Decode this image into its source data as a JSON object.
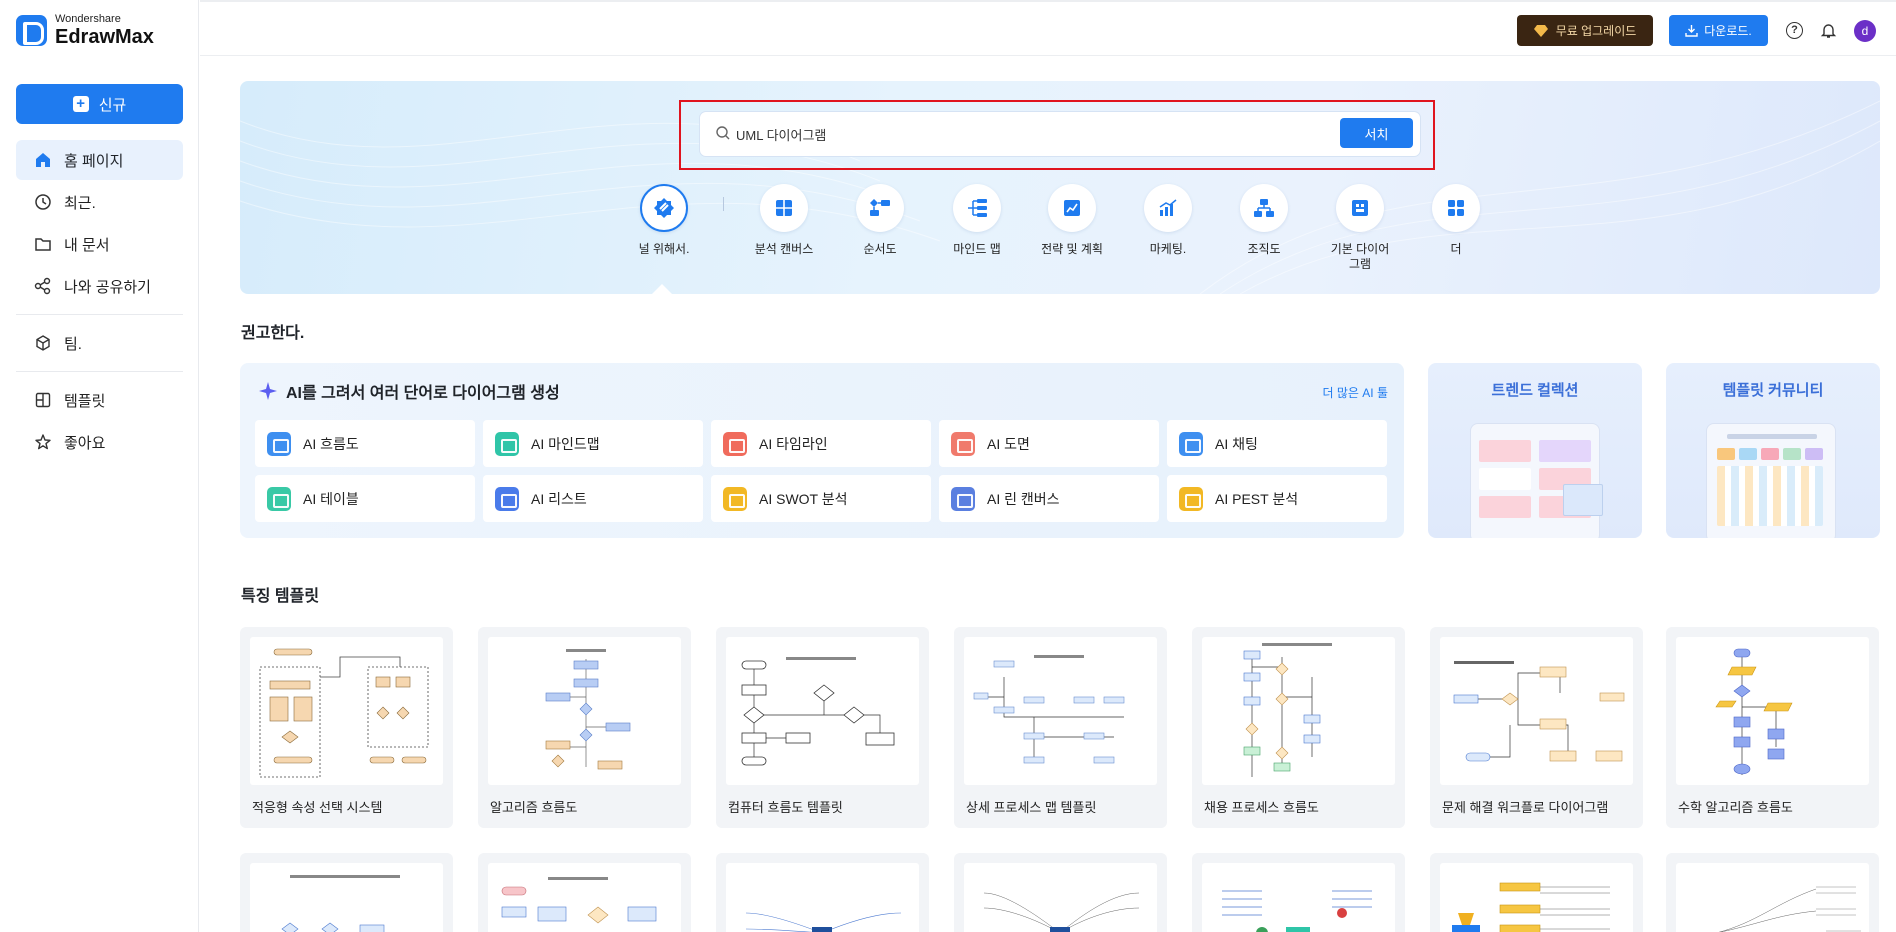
{
  "brand": {
    "sub": "Wondershare",
    "name": "EdrawMax",
    "color": "#1f7bef"
  },
  "sidebar": {
    "new_label": "신규",
    "items": [
      {
        "label": "홈 페이지",
        "icon": "home-icon",
        "active": true
      },
      {
        "label": "최근.",
        "icon": "clock-icon"
      },
      {
        "label": "내 문서",
        "icon": "folder-icon"
      },
      {
        "label": "나와 공유하기",
        "icon": "share-icon"
      },
      {
        "label": "팀.",
        "icon": "cube-icon"
      },
      {
        "label": "템플릿",
        "icon": "template-icon"
      },
      {
        "label": "좋아요",
        "icon": "star-icon"
      }
    ]
  },
  "topbar": {
    "upgrade_label": "무료 업그레이드",
    "download_label": "다운로드.",
    "avatar_letter": "d"
  },
  "search": {
    "value": "UML 다이어그램",
    "button_label": "서치"
  },
  "categories": [
    {
      "label": "널 위해서.",
      "icon": "for-you-icon",
      "active": true
    },
    {
      "label": "분석 캔버스",
      "icon": "canvas-icon"
    },
    {
      "label": "순서도",
      "icon": "flowchart-icon"
    },
    {
      "label": "마인드 맵",
      "icon": "mindmap-icon"
    },
    {
      "label": "전략 및 계획",
      "icon": "strategy-icon"
    },
    {
      "label": "마케팅.",
      "icon": "chart-icon"
    },
    {
      "label": "조직도",
      "icon": "orgchart-icon"
    },
    {
      "label": "기본 다이어 그램",
      "icon": "basic-diagram-icon"
    },
    {
      "label": "더",
      "icon": "more-icon"
    }
  ],
  "recommended": {
    "title": "권고한다.",
    "ai_title": "AI를 그려서 여러 단어로 다이어그램 생성",
    "ai_more": "더 많은 AI 툴",
    "ai_tools": [
      {
        "label": "AI 흐름도",
        "color": "#3e8ff0"
      },
      {
        "label": "AI 마인드맵",
        "color": "#2fc5a8"
      },
      {
        "label": "AI 타임라인",
        "color": "#f06b5c"
      },
      {
        "label": "AI 도면",
        "color": "#f07a6c"
      },
      {
        "label": "AI 채팅",
        "color": "#3e8ff0"
      },
      {
        "label": "AI 테이블",
        "color": "#39c9a6"
      },
      {
        "label": "AI 리스트",
        "color": "#4a7bea"
      },
      {
        "label": "AI SWOT 분석",
        "color": "#f2b824"
      },
      {
        "label": "AI 린 캔버스",
        "color": "#5a7fe0"
      },
      {
        "label": "AI PEST 분석",
        "color": "#f2b824"
      }
    ],
    "promos": [
      {
        "title": "트렌드 컬렉션"
      },
      {
        "title": "템플릿 커뮤니티"
      }
    ]
  },
  "featured": {
    "title": "특징 템플릿",
    "templates": [
      {
        "name": "적응형 속성 선택 시스템"
      },
      {
        "name": "알고리즘 흐름도"
      },
      {
        "name": "컴퓨터 흐름도 템플릿"
      },
      {
        "name": "상세 프로세스 맵 템플릿"
      },
      {
        "name": "채용 프로세스 흐름도"
      },
      {
        "name": "문제 해결 워크플로 다이어그램"
      },
      {
        "name": "수학 알고리즘 흐름도"
      }
    ]
  }
}
